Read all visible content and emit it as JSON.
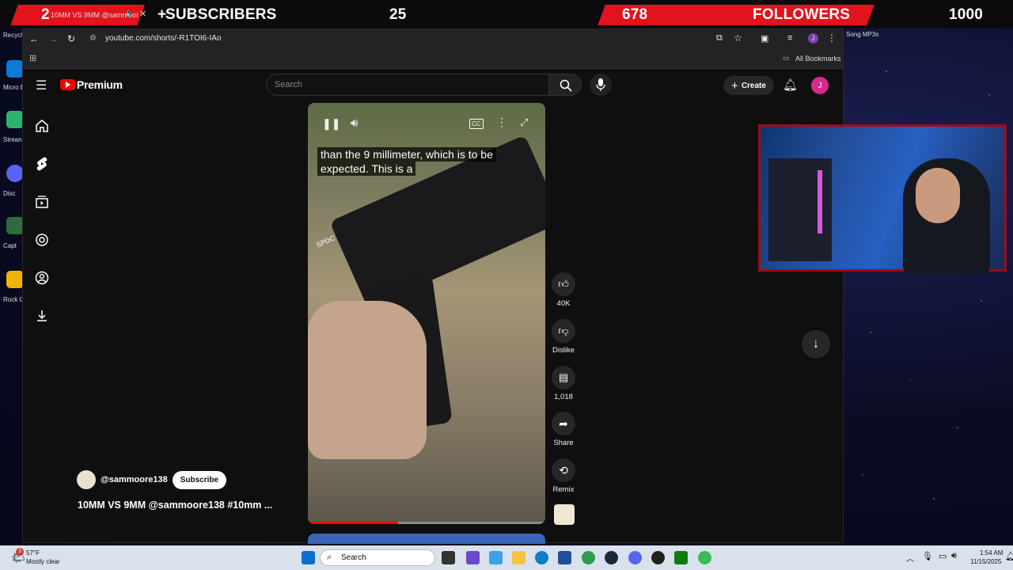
{
  "overlay": {
    "tab_number": "2",
    "tab_title": "10MM VS 9MM @sammoor",
    "subscribers_label": "SUBSCRIBERS",
    "subscribers_goal": "25",
    "followers_count": "678",
    "followers_label": "FOLLOWERS",
    "followers_goal": "1000",
    "plus": "+"
  },
  "desktop": {
    "icons": [
      {
        "label": "Recycl"
      },
      {
        "label": "Micro Edg"
      },
      {
        "label": "Strean Desk"
      },
      {
        "label": "Disc"
      },
      {
        "label": "Capt"
      },
      {
        "label": "Rock Game"
      }
    ],
    "right_label": "Song MP3s"
  },
  "browser": {
    "url": "youtube.com/shorts/-R1TOI6-IAo",
    "bookmarks_label": "All Bookmarks",
    "profile_initial": "J"
  },
  "youtube": {
    "logo": "Premium",
    "search_placeholder": "Search",
    "create_label": "Create",
    "avatar_initial": "J",
    "cc_label": "CC"
  },
  "short": {
    "caption_line1": "than the 9 millimeter, which is to be",
    "caption_line2": "expected. This is a",
    "progress": 0.38,
    "channel": "@sammoore138",
    "subscribe_label": "Subscribe",
    "title": "10MM VS 9MM @sammoore138 #10mm ...",
    "gun_marking": "SPDC"
  },
  "actions": [
    {
      "name": "like",
      "label": "40K"
    },
    {
      "name": "dislike",
      "label": "Dislike"
    },
    {
      "name": "comments",
      "label": "1,018"
    },
    {
      "name": "share",
      "label": "Share"
    },
    {
      "name": "remix",
      "label": "Remix"
    }
  ],
  "taskbar": {
    "temp": "57°F",
    "weather": "Mostly clear",
    "search_label": "Search",
    "time": "1:54 AM",
    "date": "11/15/2025",
    "notif_badge": "3"
  },
  "colors": {
    "accent_red": "#e2131d",
    "yt_red": "#ff0000",
    "avatar_pink": "#d62a8c"
  }
}
